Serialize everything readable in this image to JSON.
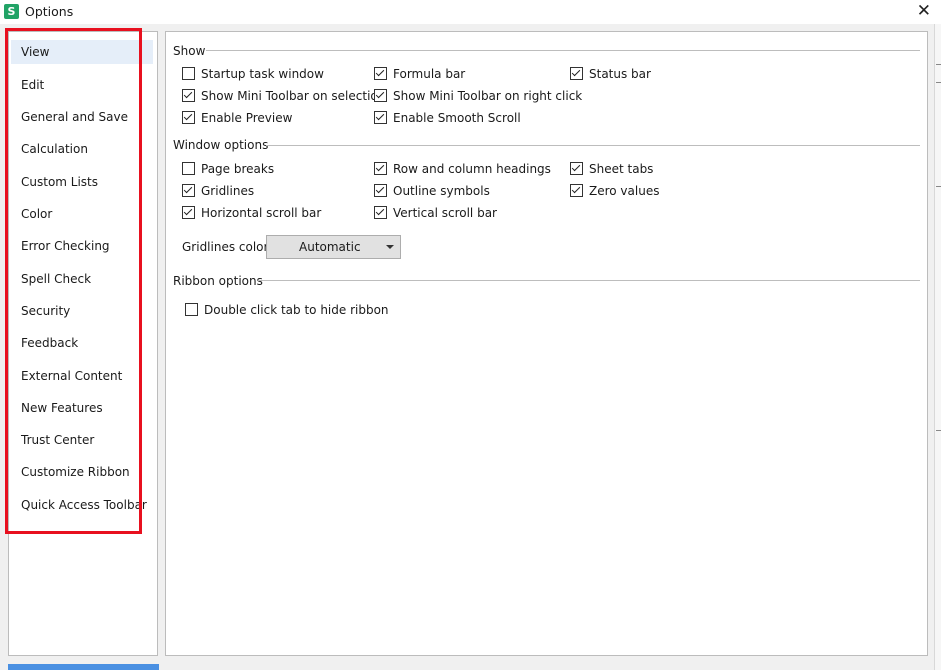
{
  "window": {
    "title": "Options",
    "icon_letter": "S",
    "icon_color": "#21a366",
    "close_glyph": "✕"
  },
  "sidebar": {
    "items": [
      {
        "label": "View",
        "active": true
      },
      {
        "label": "Edit"
      },
      {
        "label": "General and Save"
      },
      {
        "label": "Calculation"
      },
      {
        "label": "Custom Lists"
      },
      {
        "label": "Color"
      },
      {
        "label": "Error Checking"
      },
      {
        "label": "Spell Check"
      },
      {
        "label": "Security"
      },
      {
        "label": "Feedback"
      },
      {
        "label": "External Content"
      },
      {
        "label": "New Features"
      },
      {
        "label": "Trust Center"
      },
      {
        "label": "Customize Ribbon"
      },
      {
        "label": "Quick Access Toolbar"
      }
    ],
    "highlight_color": "#e8101f"
  },
  "show": {
    "header": "Show",
    "options": [
      {
        "label": "Startup task window",
        "checked": false
      },
      {
        "label": "Formula bar",
        "checked": true
      },
      {
        "label": "Status bar",
        "checked": true
      },
      {
        "label": "Show Mini Toolbar on selection",
        "checked": true
      },
      {
        "label": "Show Mini Toolbar on right click",
        "checked": true
      },
      {
        "label": "Enable Preview",
        "checked": true
      },
      {
        "label": "Enable Smooth Scroll",
        "checked": true
      }
    ]
  },
  "window_options": {
    "header": "Window options",
    "options": [
      {
        "label": "Page breaks",
        "checked": false
      },
      {
        "label": "Row and column headings",
        "checked": true
      },
      {
        "label": "Sheet tabs",
        "checked": true
      },
      {
        "label": "Gridlines",
        "checked": true
      },
      {
        "label": "Outline symbols",
        "checked": true
      },
      {
        "label": "Zero values",
        "checked": true
      },
      {
        "label": "Horizontal scroll bar",
        "checked": true
      },
      {
        "label": "Vertical scroll bar",
        "checked": true
      }
    ],
    "gridlines_color_label": "Gridlines color:",
    "gridlines_color_value": "Automatic"
  },
  "ribbon_options": {
    "header": "Ribbon options",
    "options": [
      {
        "label": "Double click tab to hide ribbon",
        "checked": false
      }
    ]
  }
}
